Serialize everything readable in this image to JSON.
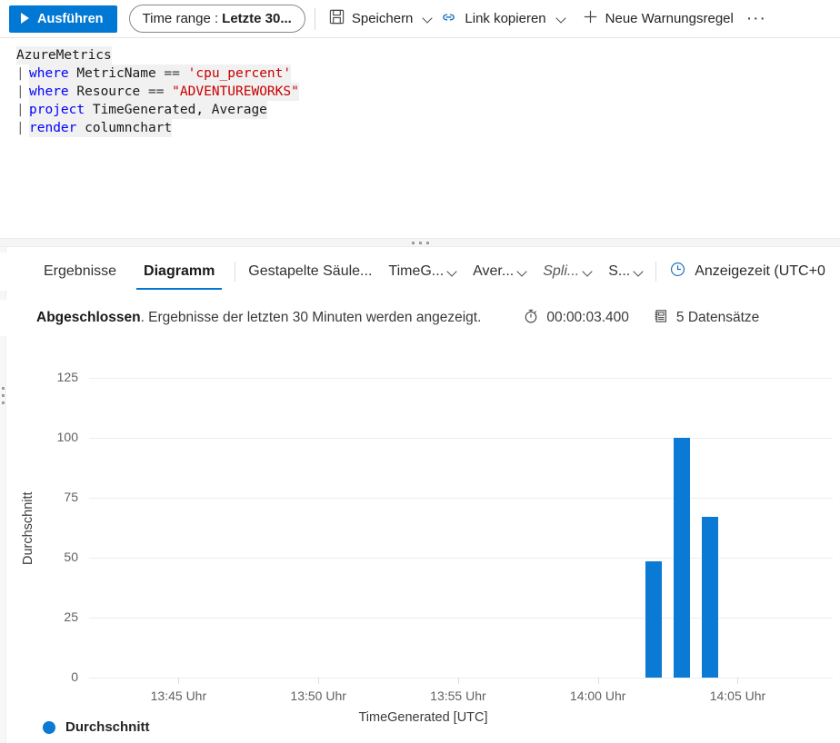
{
  "toolbar": {
    "run_label": "Ausführen",
    "time_range_label": "Time range :",
    "time_range_value": "Letzte 30...",
    "save_label": "Speichern",
    "copy_link_label": "Link kopieren",
    "new_alert_label": "Neue Warnungsregel",
    "more_label": "···"
  },
  "editor": {
    "lines": [
      {
        "pipe": "",
        "parts": [
          {
            "t": "AzureMetrics",
            "c": "ident"
          }
        ]
      },
      {
        "pipe": "|",
        "parts": [
          {
            "t": "where ",
            "c": "kw"
          },
          {
            "t": "MetricName ",
            "c": "ident"
          },
          {
            "t": "== ",
            "c": "op"
          },
          {
            "t": "'cpu_percent'",
            "c": "str"
          }
        ]
      },
      {
        "pipe": "|",
        "parts": [
          {
            "t": "where ",
            "c": "kw"
          },
          {
            "t": "Resource ",
            "c": "ident"
          },
          {
            "t": "== ",
            "c": "op"
          },
          {
            "t": "\"ADVENTUREWORKS\"",
            "c": "str"
          }
        ]
      },
      {
        "pipe": "|",
        "parts": [
          {
            "t": "project ",
            "c": "kw"
          },
          {
            "t": "TimeGenerated, Average",
            "c": "ident"
          }
        ]
      },
      {
        "pipe": "|",
        "parts": [
          {
            "t": "render ",
            "c": "kw"
          },
          {
            "t": "columnchart",
            "c": "ident"
          }
        ]
      }
    ]
  },
  "tabs": {
    "results_label": "Ergebnisse",
    "chart_label": "Diagramm",
    "active": "Diagramm"
  },
  "chart_controls": {
    "chart_type": "Gestapelte Säule...",
    "x_axis": "TimeG...",
    "y_axis": "Aver...",
    "split_by": "Spli...",
    "aggregation": "S...",
    "timezone": "Anzeigezeit (UTC+0"
  },
  "status": {
    "state": "Abgeschlossen",
    "message": ". Ergebnisse der letzten 30 Minuten werden angezeigt.",
    "duration": "00:00:03.400",
    "records": "5 Datensätze"
  },
  "colors": {
    "accent": "#0078d4",
    "series": "#0b7ad4",
    "keyword": "#0000ff",
    "string": "#c80000"
  },
  "chart_data": {
    "type": "bar",
    "title": "",
    "xlabel": "TimeGenerated [UTC]",
    "ylabel": "Durchschnitt",
    "ylim": [
      0,
      125
    ],
    "yticks": [
      0,
      25,
      50,
      75,
      100,
      125
    ],
    "grid": true,
    "legend_position": "bottom-left",
    "xticks": [
      "13:45 Uhr",
      "13:50 Uhr",
      "13:55 Uhr",
      "14:00 Uhr",
      "14:05 Uhr"
    ],
    "x_axis_minutes": [
      825,
      830,
      835,
      840,
      845
    ],
    "series": [
      {
        "name": "Durchschnitt",
        "color": "#0b7ad4",
        "points": [
          {
            "x_minutes": 842.0,
            "label": "14:02 Uhr",
            "value": 48.5
          },
          {
            "x_minutes": 843.0,
            "label": "14:03 Uhr",
            "value": 100
          },
          {
            "x_minutes": 844.0,
            "label": "14:04 Uhr",
            "value": 67
          }
        ]
      }
    ]
  },
  "legend": {
    "label": "Durchschnitt"
  }
}
